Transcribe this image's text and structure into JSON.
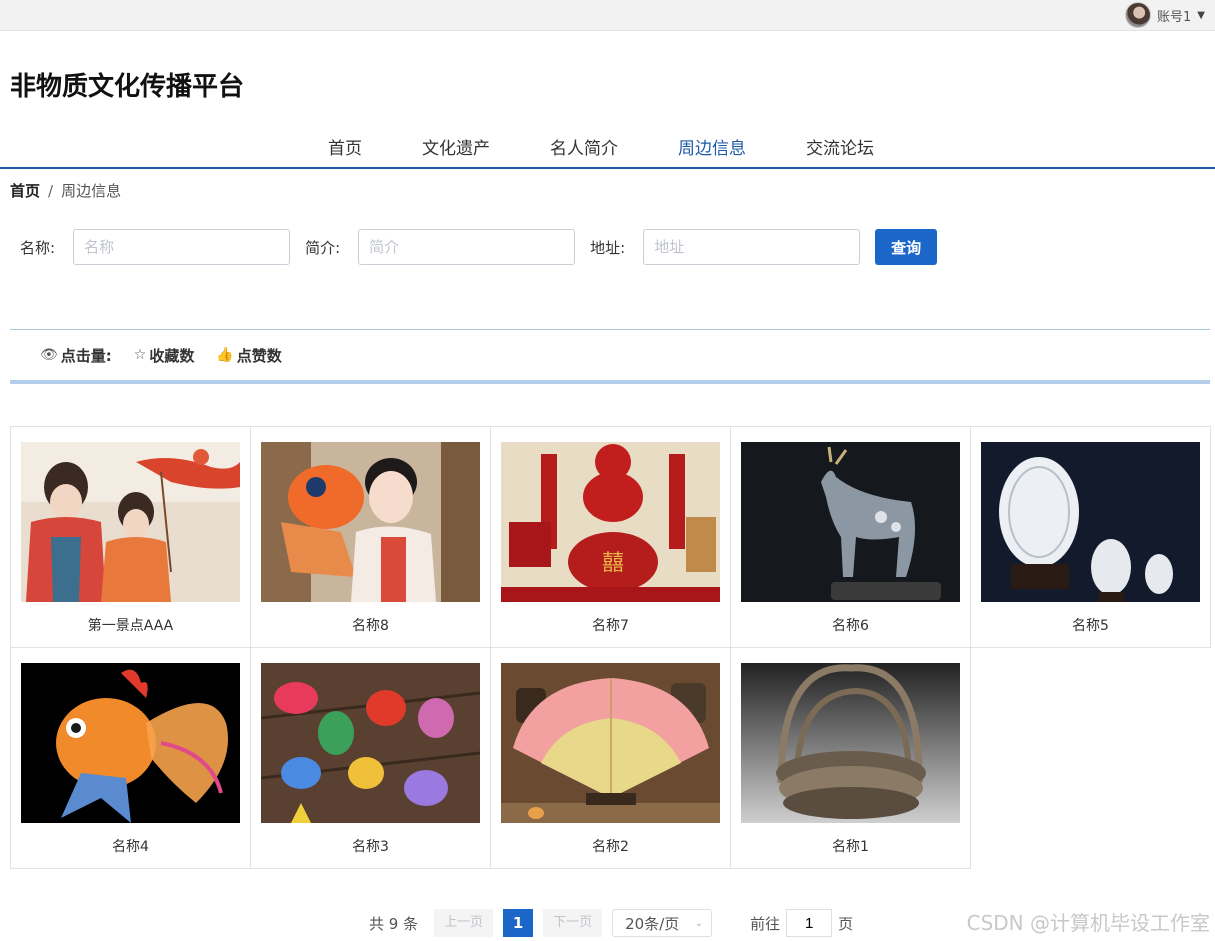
{
  "account": {
    "name": "账号1"
  },
  "site_title": "非物质文化传播平台",
  "nav": {
    "items": [
      "首页",
      "文化遗产",
      "名人简介",
      "周边信息",
      "交流论坛"
    ],
    "active": "周边信息"
  },
  "breadcrumb": {
    "home": "首页",
    "separator": "/",
    "current": "周边信息"
  },
  "search": {
    "name_label": "名称:",
    "name_placeholder": "名称",
    "intro_label": "简介:",
    "intro_placeholder": "简介",
    "address_label": "地址:",
    "address_placeholder": "地址",
    "query_button": "查询"
  },
  "sort": {
    "clicks": "点击量:",
    "favorites": "收藏数",
    "likes": "点赞数"
  },
  "items": [
    {
      "name": "第一景点AAA",
      "image": "two women in red hanfu with carp kite"
    },
    {
      "name": "名称8",
      "image": "girl in hanfu holding koi fish lantern"
    },
    {
      "name": "名称7",
      "image": "red wedding chopsticks and comb set"
    },
    {
      "name": "名称6",
      "image": "silver deer sculpture on dark background"
    },
    {
      "name": "名称5",
      "image": "carved eggshell art on dark background"
    },
    {
      "name": "名称4",
      "image": "goldfish lantern on black background"
    },
    {
      "name": "名称3",
      "image": "colorful fish sachets on wood"
    },
    {
      "name": "名称2",
      "image": "pink folding fan on stand"
    },
    {
      "name": "名称1",
      "image": "woven rattan baskets"
    }
  ],
  "pagination": {
    "total_text": "共 9 条",
    "prev": "上一页",
    "current_page": "1",
    "next": "下一页",
    "page_size": "20条/页",
    "goto_label": "前往",
    "goto_value": "1",
    "page_suffix": "页"
  },
  "watermark": "CSDN @计算机毕设工作室"
}
